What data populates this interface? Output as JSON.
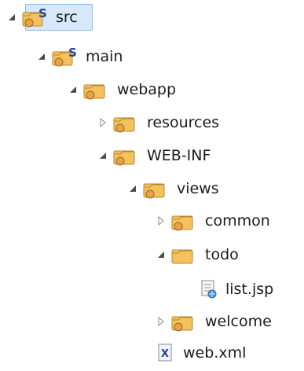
{
  "tree": {
    "nodes": [
      {
        "name": "src",
        "kind": "source-folder",
        "state": "expanded",
        "selected": true
      },
      {
        "name": "main",
        "kind": "source-folder",
        "state": "expanded"
      },
      {
        "name": "webapp",
        "kind": "folder",
        "state": "expanded"
      },
      {
        "name": "resources",
        "kind": "folder",
        "state": "collapsed"
      },
      {
        "name": "WEB-INF",
        "kind": "folder",
        "state": "expanded"
      },
      {
        "name": "views",
        "kind": "folder",
        "state": "expanded"
      },
      {
        "name": "common",
        "kind": "folder",
        "state": "collapsed"
      },
      {
        "name": "todo",
        "kind": "plain-folder",
        "state": "expanded"
      },
      {
        "name": "list.jsp",
        "kind": "jsp-file",
        "state": "leaf"
      },
      {
        "name": "welcome",
        "kind": "folder",
        "state": "collapsed"
      },
      {
        "name": "web.xml",
        "kind": "xml-file",
        "state": "leaf"
      }
    ],
    "source_badge": "S",
    "xml_badge": "X",
    "colors": {
      "folder": "#f3c15e",
      "folder_dark": "#b8862a",
      "selection": "#d7e8f8",
      "selection_border": "#8fb8e4",
      "twisty": "#4a4a4a",
      "badge_blue": "#1f3fa8"
    }
  }
}
